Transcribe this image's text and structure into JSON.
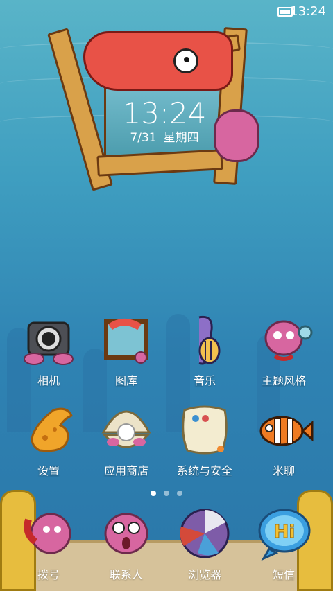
{
  "status_bar": {
    "time": "13:24"
  },
  "clock_widget": {
    "time": "13:24",
    "date": "7/31",
    "weekday": "星期四"
  },
  "apps_row1": [
    {
      "label": "相机",
      "icon": "camera-icon"
    },
    {
      "label": "图库",
      "icon": "gallery-icon"
    },
    {
      "label": "音乐",
      "icon": "music-icon"
    },
    {
      "label": "主题风格",
      "icon": "themes-icon"
    }
  ],
  "apps_row2": [
    {
      "label": "设置",
      "icon": "settings-icon"
    },
    {
      "label": "应用商店",
      "icon": "app-store-icon"
    },
    {
      "label": "系统与安全",
      "icon": "security-icon"
    },
    {
      "label": "米聊",
      "icon": "miliao-icon"
    }
  ],
  "dock": [
    {
      "label": "拨号",
      "icon": "phone-icon"
    },
    {
      "label": "联系人",
      "icon": "contacts-icon"
    },
    {
      "label": "浏览器",
      "icon": "browser-icon"
    },
    {
      "label": "短信",
      "icon": "messages-icon",
      "badge_text": "Hi"
    }
  ],
  "page_indicator": {
    "pages": 3,
    "current": 1
  },
  "colors": {
    "water_top": "#59b4c8",
    "water_bottom": "#2a76a8",
    "sand": "#d6c29a",
    "wood": "#d9a14a",
    "shrimp": "#e85247",
    "octopus": "#d766a0"
  }
}
